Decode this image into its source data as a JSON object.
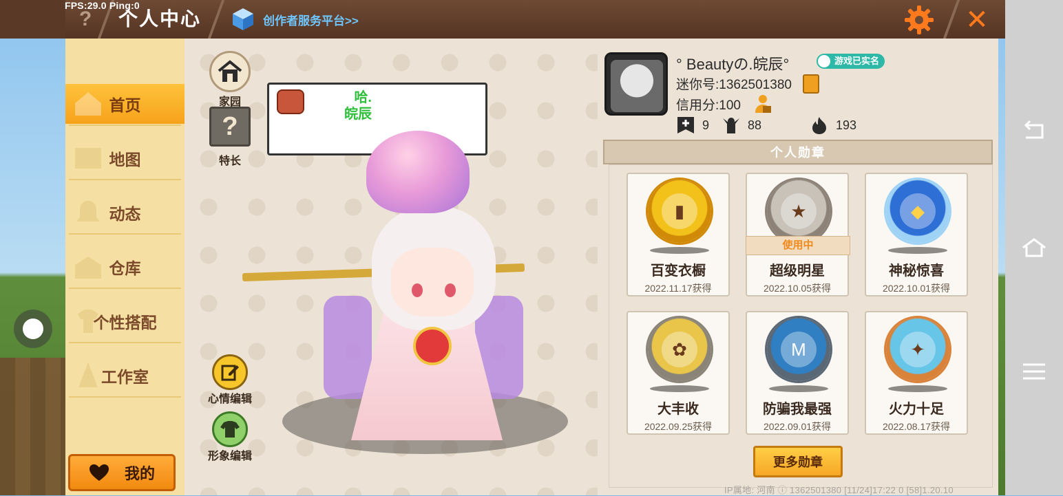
{
  "overlay": {
    "fps_text": "FPS:29.0  Ping:0"
  },
  "header": {
    "help_glyph": "?",
    "title": "个人中心",
    "creator_link": "创作者服务平台>>",
    "close_glyph": "✕",
    "icons": [
      "help-icon",
      "cube-icon",
      "gear-icon",
      "close-icon"
    ],
    "accent_color": "#ff7a1c"
  },
  "sidebar": {
    "tabs": [
      {
        "label": "首页",
        "active": true
      },
      {
        "label": "地图",
        "active": false
      },
      {
        "label": "动态",
        "active": false
      },
      {
        "label": "仓库",
        "active": false
      },
      {
        "label": "个性搭配",
        "active": false
      },
      {
        "label": "工作室",
        "active": false
      }
    ],
    "mine_button": "我的"
  },
  "character": {
    "home_label": "家园",
    "talent_glyph": "?",
    "talent_label": "特长",
    "mood_edit_label": "心情编辑",
    "look_edit_label": "形象编辑",
    "mood_text": "哈.\n皖辰"
  },
  "profile": {
    "nickname": "° Beautyの.皖辰°",
    "verified_badge": "游戏已实名",
    "mini_id": "迷你号:1362501380",
    "credit": "信用分:100",
    "stats": [
      {
        "icon": "add-friend-icon",
        "value": "9"
      },
      {
        "icon": "fans-icon",
        "value": "88"
      },
      {
        "icon": "fire-icon",
        "value": "193"
      }
    ]
  },
  "medals": {
    "header": "个人勋章",
    "in_use_label": "使用中",
    "items": [
      {
        "name": "百变衣橱",
        "date": "2022.11.17获得",
        "in_use": false,
        "color": "#f3c21a",
        "ring": "#d18a08"
      },
      {
        "name": "超级明星",
        "date": "2022.10.05获得",
        "in_use": true,
        "color": "#c8c2b8",
        "ring": "#8c8278"
      },
      {
        "name": "神秘惊喜",
        "date": "2022.10.01获得",
        "in_use": false,
        "color": "#2e6fd6",
        "ring": "#9fd3f5"
      },
      {
        "name": "大丰收",
        "date": "2022.09.25获得",
        "in_use": false,
        "color": "#e9c649",
        "ring": "#8a8377"
      },
      {
        "name": "防骗我最强",
        "date": "2022.09.01获得",
        "in_use": false,
        "color": "#2f7fc2",
        "ring": "#5a6775"
      },
      {
        "name": "火力十足",
        "date": "2022.08.17获得",
        "in_use": false,
        "color": "#67c5e8",
        "ring": "#d9823a"
      }
    ],
    "more_button": "更多勋章"
  },
  "footer": {
    "ip_info": "IP属地: 河南 ⓘ      1362501380     [11/24]17:22 0  [58]1.20.10"
  }
}
